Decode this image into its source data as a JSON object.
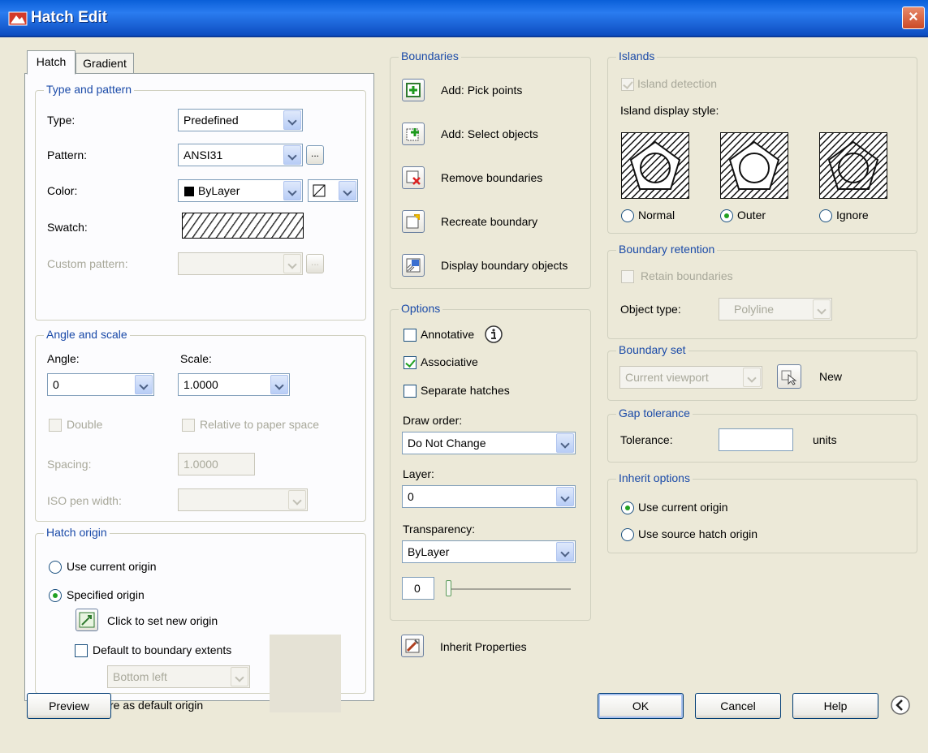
{
  "window": {
    "title": "Hatch Edit",
    "close_label": "×"
  },
  "tabs": [
    {
      "label": "Hatch"
    },
    {
      "label": "Gradient"
    }
  ],
  "type_pattern": {
    "legend": "Type and pattern",
    "type_label": "Type:",
    "type_value": "Predefined",
    "pattern_label": "Pattern:",
    "pattern_value": "ANSI31",
    "pattern_browse": "...",
    "color_label": "Color:",
    "color_value": "ByLayer",
    "swatch_color": "#000000",
    "swatch_label": "Swatch:",
    "custom_pattern_label": "Custom pattern:",
    "custom_browse": "..."
  },
  "angle_scale": {
    "legend": "Angle and scale",
    "angle_label": "Angle:",
    "angle_value": "0",
    "scale_label": "Scale:",
    "scale_value": "1.0000",
    "double_label": "Double",
    "relative_label": "Relative to paper space",
    "spacing_label": "Spacing:",
    "spacing_value": "1.0000",
    "iso_label": "ISO pen width:"
  },
  "hatch_origin": {
    "legend": "Hatch origin",
    "use_current": "Use current origin",
    "specified": "Specified origin",
    "click_set": "Click to set new origin",
    "default_boundary": "Default to boundary extents",
    "position_value": "Bottom left",
    "store_default": "Store as default origin"
  },
  "boundaries": {
    "legend": "Boundaries",
    "add_pick": "Add: Pick points",
    "add_select": "Add: Select objects",
    "remove": "Remove boundaries",
    "recreate": "Recreate boundary",
    "display": "Display boundary objects"
  },
  "options": {
    "legend": "Options",
    "annotative": "Annotative",
    "associative": "Associative",
    "separate": "Separate hatches",
    "draw_order_label": "Draw order:",
    "draw_order_value": "Do Not Change",
    "layer_label": "Layer:",
    "layer_value": "0",
    "transparency_label": "Transparency:",
    "transparency_value": "ByLayer",
    "transparency_number": "0"
  },
  "inherit_properties": "Inherit Properties",
  "islands": {
    "legend": "Islands",
    "detection": "Island detection",
    "display_style": "Island display style:",
    "normal": "Normal",
    "outer": "Outer",
    "ignore": "Ignore"
  },
  "boundary_retention": {
    "legend": "Boundary retention",
    "retain": "Retain boundaries",
    "object_type_label": "Object type:",
    "object_type_value": "Polyline"
  },
  "boundary_set": {
    "legend": "Boundary set",
    "value": "Current viewport",
    "new_label": "New"
  },
  "gap_tolerance": {
    "legend": "Gap tolerance",
    "tolerance_label": "Tolerance:",
    "tolerance_value": "",
    "units": "units"
  },
  "inherit_options": {
    "legend": "Inherit options",
    "use_current": "Use current origin",
    "use_source": "Use source hatch origin"
  },
  "buttons": {
    "preview": "Preview",
    "ok": "OK",
    "cancel": "Cancel",
    "help": "Help"
  }
}
